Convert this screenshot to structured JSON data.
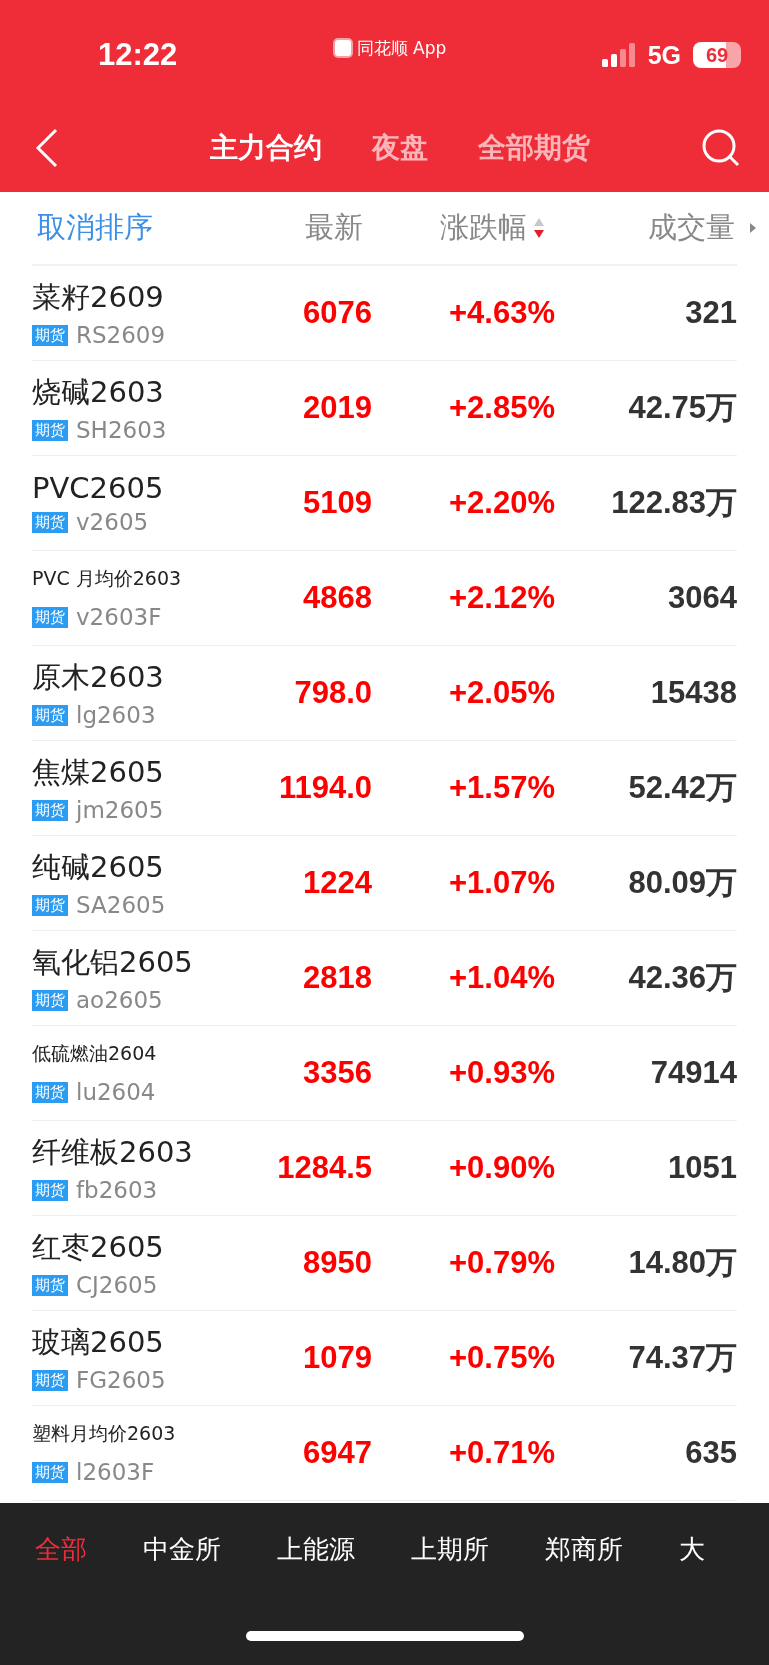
{
  "status_bar": {
    "time": "12:22",
    "app": "同花顺 App",
    "network": "5G",
    "battery": "69"
  },
  "header": {
    "tabs": [
      {
        "label": "主力合约",
        "selected": true
      },
      {
        "label": "夜盘",
        "selected": false
      },
      {
        "label": "全部期货",
        "selected": false
      }
    ]
  },
  "table": {
    "cancel_sort": "取消排序",
    "columns": [
      {
        "label": "最新",
        "sorted": false
      },
      {
        "label": "涨跌幅",
        "sorted": true
      },
      {
        "label": "成交量",
        "sorted": false
      }
    ],
    "rows": [
      {
        "name": "菜籽2609",
        "compact": false,
        "tag": "期货",
        "code": "RS2609",
        "price": "6076",
        "change": "+4.63%",
        "volume": "321"
      },
      {
        "name": "烧碱2603",
        "compact": false,
        "tag": "期货",
        "code": "SH2603",
        "price": "2019",
        "change": "+2.85%",
        "volume": "42.75万"
      },
      {
        "name": "PVC2605",
        "compact": false,
        "tag": "期货",
        "code": "v2605",
        "price": "5109",
        "change": "+2.20%",
        "volume": "122.83万"
      },
      {
        "name": "PVC 月均价2603",
        "compact": true,
        "tag": "期货",
        "code": "v2603F",
        "price": "4868",
        "change": "+2.12%",
        "volume": "3064"
      },
      {
        "name": "原木2603",
        "compact": false,
        "tag": "期货",
        "code": "lg2603",
        "price": "798.0",
        "change": "+2.05%",
        "volume": "15438"
      },
      {
        "name": "焦煤2605",
        "compact": false,
        "tag": "期货",
        "code": "jm2605",
        "price": "1194.0",
        "change": "+1.57%",
        "volume": "52.42万"
      },
      {
        "name": "纯碱2605",
        "compact": false,
        "tag": "期货",
        "code": "SA2605",
        "price": "1224",
        "change": "+1.07%",
        "volume": "80.09万"
      },
      {
        "name": "氧化铝2605",
        "compact": false,
        "tag": "期货",
        "code": "ao2605",
        "price": "2818",
        "change": "+1.04%",
        "volume": "42.36万"
      },
      {
        "name": "低硫燃油2604",
        "compact": true,
        "tag": "期货",
        "code": "lu2604",
        "price": "3356",
        "change": "+0.93%",
        "volume": "74914"
      },
      {
        "name": "纤维板2603",
        "compact": false,
        "tag": "期货",
        "code": "fb2603",
        "price": "1284.5",
        "change": "+0.90%",
        "volume": "1051"
      },
      {
        "name": "红枣2605",
        "compact": false,
        "tag": "期货",
        "code": "CJ2605",
        "price": "8950",
        "change": "+0.79%",
        "volume": "14.80万"
      },
      {
        "name": "玻璃2605",
        "compact": false,
        "tag": "期货",
        "code": "FG2605",
        "price": "1079",
        "change": "+0.75%",
        "volume": "74.37万"
      },
      {
        "name": "塑料月均价2603",
        "compact": true,
        "tag": "期货",
        "code": "l2603F",
        "price": "6947",
        "change": "+0.71%",
        "volume": "635"
      }
    ]
  },
  "exchange_tabs": [
    {
      "label": "全部",
      "selected": true
    },
    {
      "label": "中金所",
      "selected": false
    },
    {
      "label": "上能源",
      "selected": false
    },
    {
      "label": "上期所",
      "selected": false
    },
    {
      "label": "郑商所",
      "selected": false
    },
    {
      "label": "大",
      "selected": false
    }
  ]
}
